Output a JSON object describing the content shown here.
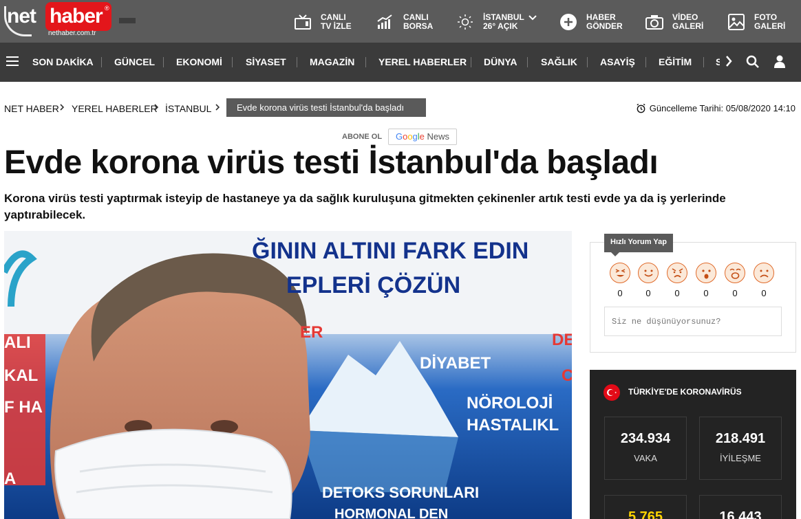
{
  "logo": {
    "net": "net",
    "haber": "haber",
    "reg": "®",
    "domain": "nethaber.com.tr"
  },
  "top_links": [
    {
      "icon": "tv-icon",
      "line1": "CANLI",
      "line2": "TV İZLE"
    },
    {
      "icon": "chart-icon",
      "line1": "CANLI",
      "line2": "BORSA"
    },
    {
      "icon": "sun-icon",
      "line1": "İSTANBUL",
      "line2": "26° AÇIK"
    },
    {
      "icon": "plus-circle-icon",
      "line1": "HABER",
      "line2": "GÖNDER"
    },
    {
      "icon": "camera-icon",
      "line1": "VİDEO",
      "line2": "GALERİ"
    },
    {
      "icon": "image-icon",
      "line1": "FOTO",
      "line2": "GALERİ"
    }
  ],
  "nav": {
    "items": [
      "SON DAKİKA",
      "GÜNCEL",
      "EKONOMİ",
      "SİYASET",
      "MAGAZİN",
      "YEREL HABERLER",
      "DÜNYA",
      "SAĞLIK",
      "ASAYİŞ",
      "EĞİTİM",
      "S"
    ]
  },
  "breadcrumb": {
    "items": [
      "NET HABER",
      "YEREL HABERLER",
      "İSTANBUL"
    ],
    "current": "Evde korona virüs testi İstanbul'da başladı"
  },
  "updated": "Güncelleme Tarihi: 05/08/2020 14:10",
  "subscribe": {
    "label": "ABONE OL",
    "google": [
      "G",
      "o",
      "o",
      "g",
      "l",
      "e"
    ],
    "news": "News"
  },
  "article": {
    "title": "Evde korona virüs testi İstanbul'da başladı",
    "summary": "Korona virüs testi yaptırmak isteyip de hastaneye ya da sağlık kuruluşuna gitmekten çekinenler artık testi evde ya da iş yerlerinde yaptırabilecek.",
    "image_text": {
      "line1": "ĞININ ALTINI FARK EDIN",
      "line2": "EPLERİ ÇÖZÜN",
      "diyabet": "DİYABET",
      "noroloji": "NÖROLOJİ",
      "hastalik": "HASTALIKL",
      "detoks": "DETOKS SORUNLARI",
      "hormonal": "HORMONAL DEN",
      "ali": "ALI",
      "kal": "KAL",
      "fha": "F HA",
      "er": "ER",
      "de": "DE",
      "c": "C",
      "a": "A"
    }
  },
  "quick_comment": {
    "tab": "Hızlı Yorum Yap",
    "reactions": [
      {
        "icon": "laughing-face-icon",
        "count": "0"
      },
      {
        "icon": "smiling-face-icon",
        "count": "0"
      },
      {
        "icon": "angry-face-icon",
        "count": "0"
      },
      {
        "icon": "surprised-face-icon",
        "count": "0"
      },
      {
        "icon": "shocked-face-icon",
        "count": "0"
      },
      {
        "icon": "sad-face-icon",
        "count": "0"
      }
    ],
    "placeholder": "Siz ne düşünüyorsunuz?"
  },
  "covid": {
    "title": "TÜRKİYE'DE KORONAVİRÜS",
    "stats": [
      {
        "value": "234.934",
        "label": "VAKA"
      },
      {
        "value": "218.491",
        "label": "İYİLEŞME"
      },
      {
        "value": "5.765",
        "label": ""
      },
      {
        "value": "16.443",
        "label": ""
      }
    ]
  },
  "colors": {
    "brand_red": "#e3161b",
    "header_gray": "#5b5b5b",
    "nav_dark": "#3b3b3b",
    "covid_bg": "#232323",
    "covid_yellow": "#ffd400"
  }
}
